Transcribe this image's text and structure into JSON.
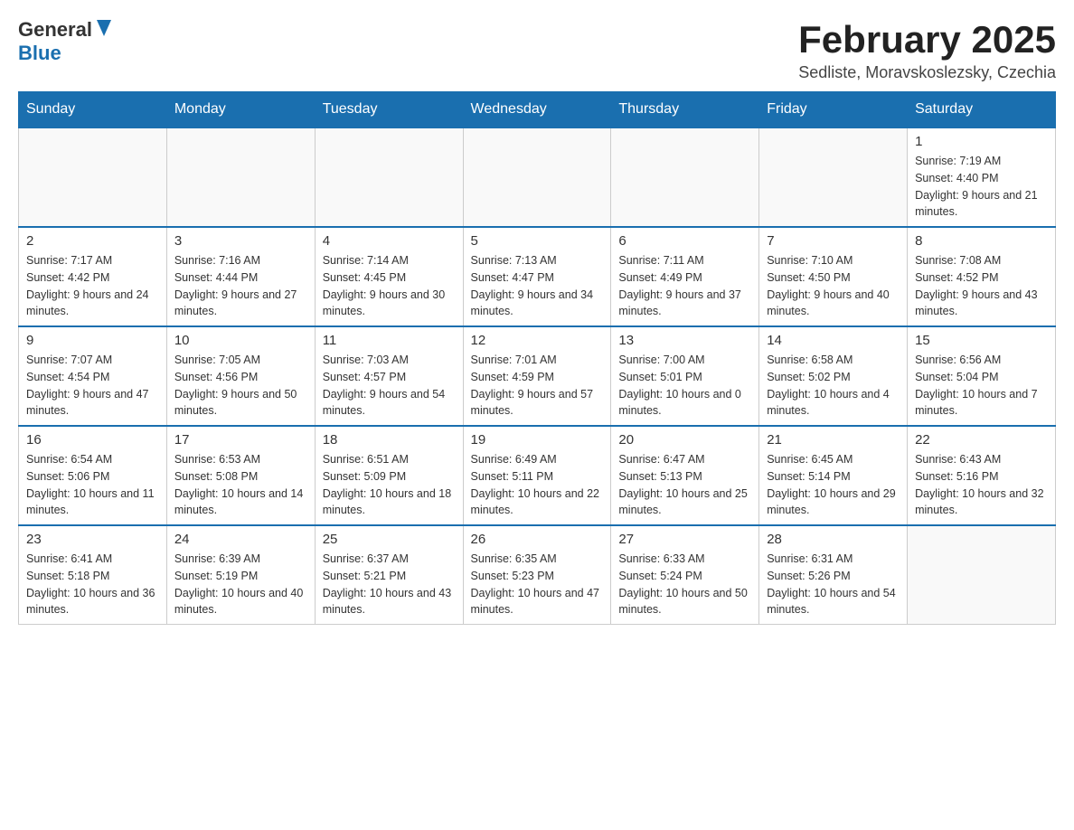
{
  "logo": {
    "text_general": "General",
    "text_blue": "Blue"
  },
  "title": {
    "month_year": "February 2025",
    "location": "Sedliste, Moravskoslezsky, Czechia"
  },
  "headers": [
    "Sunday",
    "Monday",
    "Tuesday",
    "Wednesday",
    "Thursday",
    "Friday",
    "Saturday"
  ],
  "weeks": [
    [
      {
        "day": "",
        "info": ""
      },
      {
        "day": "",
        "info": ""
      },
      {
        "day": "",
        "info": ""
      },
      {
        "day": "",
        "info": ""
      },
      {
        "day": "",
        "info": ""
      },
      {
        "day": "",
        "info": ""
      },
      {
        "day": "1",
        "info": "Sunrise: 7:19 AM\nSunset: 4:40 PM\nDaylight: 9 hours and 21 minutes."
      }
    ],
    [
      {
        "day": "2",
        "info": "Sunrise: 7:17 AM\nSunset: 4:42 PM\nDaylight: 9 hours and 24 minutes."
      },
      {
        "day": "3",
        "info": "Sunrise: 7:16 AM\nSunset: 4:44 PM\nDaylight: 9 hours and 27 minutes."
      },
      {
        "day": "4",
        "info": "Sunrise: 7:14 AM\nSunset: 4:45 PM\nDaylight: 9 hours and 30 minutes."
      },
      {
        "day": "5",
        "info": "Sunrise: 7:13 AM\nSunset: 4:47 PM\nDaylight: 9 hours and 34 minutes."
      },
      {
        "day": "6",
        "info": "Sunrise: 7:11 AM\nSunset: 4:49 PM\nDaylight: 9 hours and 37 minutes."
      },
      {
        "day": "7",
        "info": "Sunrise: 7:10 AM\nSunset: 4:50 PM\nDaylight: 9 hours and 40 minutes."
      },
      {
        "day": "8",
        "info": "Sunrise: 7:08 AM\nSunset: 4:52 PM\nDaylight: 9 hours and 43 minutes."
      }
    ],
    [
      {
        "day": "9",
        "info": "Sunrise: 7:07 AM\nSunset: 4:54 PM\nDaylight: 9 hours and 47 minutes."
      },
      {
        "day": "10",
        "info": "Sunrise: 7:05 AM\nSunset: 4:56 PM\nDaylight: 9 hours and 50 minutes."
      },
      {
        "day": "11",
        "info": "Sunrise: 7:03 AM\nSunset: 4:57 PM\nDaylight: 9 hours and 54 minutes."
      },
      {
        "day": "12",
        "info": "Sunrise: 7:01 AM\nSunset: 4:59 PM\nDaylight: 9 hours and 57 minutes."
      },
      {
        "day": "13",
        "info": "Sunrise: 7:00 AM\nSunset: 5:01 PM\nDaylight: 10 hours and 0 minutes."
      },
      {
        "day": "14",
        "info": "Sunrise: 6:58 AM\nSunset: 5:02 PM\nDaylight: 10 hours and 4 minutes."
      },
      {
        "day": "15",
        "info": "Sunrise: 6:56 AM\nSunset: 5:04 PM\nDaylight: 10 hours and 7 minutes."
      }
    ],
    [
      {
        "day": "16",
        "info": "Sunrise: 6:54 AM\nSunset: 5:06 PM\nDaylight: 10 hours and 11 minutes."
      },
      {
        "day": "17",
        "info": "Sunrise: 6:53 AM\nSunset: 5:08 PM\nDaylight: 10 hours and 14 minutes."
      },
      {
        "day": "18",
        "info": "Sunrise: 6:51 AM\nSunset: 5:09 PM\nDaylight: 10 hours and 18 minutes."
      },
      {
        "day": "19",
        "info": "Sunrise: 6:49 AM\nSunset: 5:11 PM\nDaylight: 10 hours and 22 minutes."
      },
      {
        "day": "20",
        "info": "Sunrise: 6:47 AM\nSunset: 5:13 PM\nDaylight: 10 hours and 25 minutes."
      },
      {
        "day": "21",
        "info": "Sunrise: 6:45 AM\nSunset: 5:14 PM\nDaylight: 10 hours and 29 minutes."
      },
      {
        "day": "22",
        "info": "Sunrise: 6:43 AM\nSunset: 5:16 PM\nDaylight: 10 hours and 32 minutes."
      }
    ],
    [
      {
        "day": "23",
        "info": "Sunrise: 6:41 AM\nSunset: 5:18 PM\nDaylight: 10 hours and 36 minutes."
      },
      {
        "day": "24",
        "info": "Sunrise: 6:39 AM\nSunset: 5:19 PM\nDaylight: 10 hours and 40 minutes."
      },
      {
        "day": "25",
        "info": "Sunrise: 6:37 AM\nSunset: 5:21 PM\nDaylight: 10 hours and 43 minutes."
      },
      {
        "day": "26",
        "info": "Sunrise: 6:35 AM\nSunset: 5:23 PM\nDaylight: 10 hours and 47 minutes."
      },
      {
        "day": "27",
        "info": "Sunrise: 6:33 AM\nSunset: 5:24 PM\nDaylight: 10 hours and 50 minutes."
      },
      {
        "day": "28",
        "info": "Sunrise: 6:31 AM\nSunset: 5:26 PM\nDaylight: 10 hours and 54 minutes."
      },
      {
        "day": "",
        "info": ""
      }
    ]
  ]
}
